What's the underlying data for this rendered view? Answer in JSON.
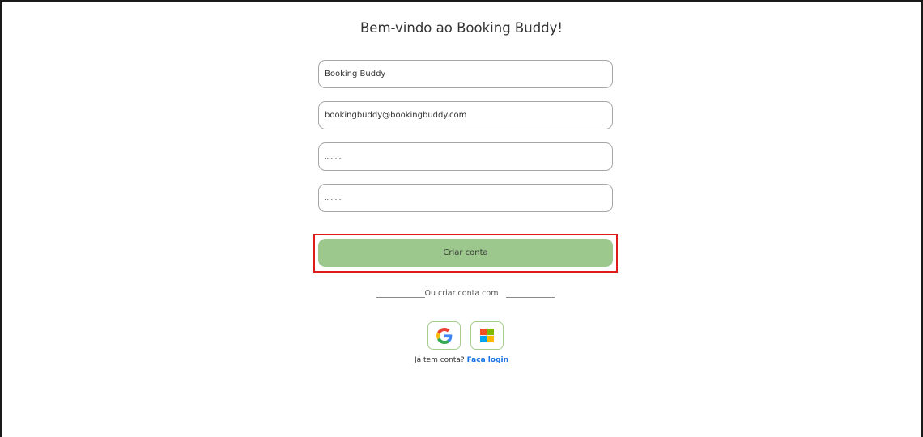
{
  "page": {
    "title": "Bem-vindo ao Booking Buddy!"
  },
  "form": {
    "name_value": "Booking Buddy",
    "email_value": "bookingbuddy@bookingbuddy.com",
    "password_value": "........",
    "confirm_password_value": "........",
    "submit_label": "Criar conta"
  },
  "social": {
    "divider_text": "Ou criar conta com",
    "google_icon": "google-icon",
    "microsoft_icon": "microsoft-icon"
  },
  "login": {
    "prompt": "Já tem conta?",
    "link_label": "Faça login"
  },
  "colors": {
    "submit_bg": "#9dc88d",
    "highlight": "#e01b1b",
    "link": "#1a73e8"
  }
}
